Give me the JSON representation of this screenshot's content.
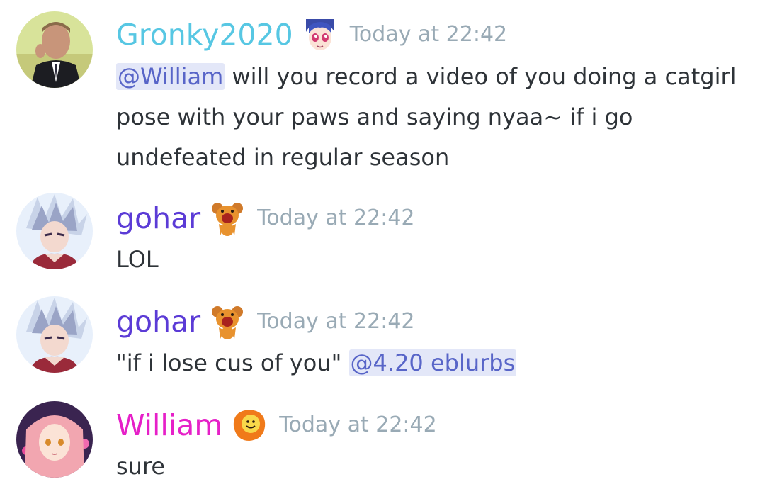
{
  "messages": [
    {
      "username": "Gronky2020",
      "username_color": "#57c7e3",
      "badge_icon": "anime-girl-emoji-icon",
      "timestamp": "Today at 22:42",
      "mention": "@William",
      "text": " will you record a video of you doing a catgirl pose with your paws and saying nyaa~ if i go undefeated in regular season",
      "avatar_icon": "man-in-suit-avatar"
    },
    {
      "username": "gohar",
      "username_color": "#5b3bd6",
      "badge_icon": "teddy-bear-emoji-icon",
      "timestamp": "Today at 22:42",
      "text": "LOL",
      "avatar_icon": "anime-silver-hair-avatar"
    },
    {
      "username": "gohar",
      "username_color": "#5b3bd6",
      "badge_icon": "teddy-bear-emoji-icon",
      "timestamp": "Today at 22:42",
      "text": "\"if i lose cus of you\" ",
      "mention": "@4.20 eblurbs",
      "avatar_icon": "anime-silver-hair-avatar"
    },
    {
      "username": "William",
      "username_color": "#e620c8",
      "badge_icon": "smiley-blob-emoji-icon",
      "timestamp": "Today at 22:42",
      "text": "sure",
      "avatar_icon": "anime-pink-hair-avatar"
    }
  ],
  "colors": {
    "mention_bg": "#e3e7f8",
    "mention_text": "#5865c8",
    "timestamp": "#99aab5",
    "message_text": "#2e3338"
  }
}
